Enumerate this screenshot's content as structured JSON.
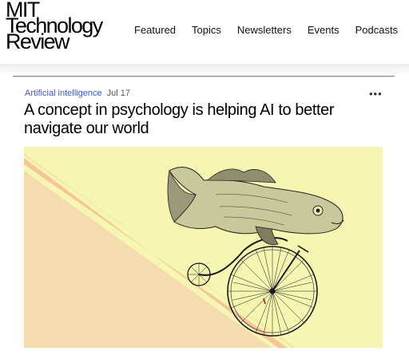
{
  "header": {
    "logo_lines": [
      "MIT",
      "Technology",
      "Review"
    ],
    "nav": [
      "Featured",
      "Topics",
      "Newsletters",
      "Events",
      "Podcasts"
    ]
  },
  "article": {
    "category": "Artificial intelligence",
    "date": "Jul 17",
    "more_icon": "more-horizontal-icon",
    "headline": "A concept in psychology is helping AI to better navigate our world"
  },
  "hero": {
    "description_icon": "fish-on-penny-farthing-illustration",
    "colors": {
      "background": "#f4f6b2",
      "peach": "#f5dcae",
      "stripe": "#f6c59a"
    }
  }
}
